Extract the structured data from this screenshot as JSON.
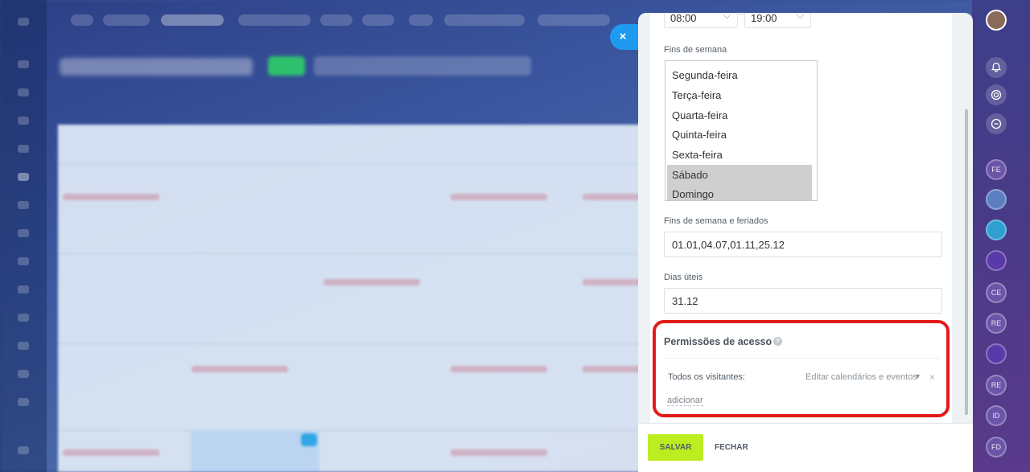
{
  "background": {
    "description_hidden": true
  },
  "panel": {
    "time_start": "08:00",
    "time_end": "19:00",
    "weekends_label": "Fins de semana",
    "weekdays": [
      {
        "label": "Segunda-feira",
        "selected": false
      },
      {
        "label": "Terça-feira",
        "selected": false
      },
      {
        "label": "Quarta-feira",
        "selected": false
      },
      {
        "label": "Quinta-feira",
        "selected": false
      },
      {
        "label": "Sexta-feira",
        "selected": false
      },
      {
        "label": "Sábado",
        "selected": true
      },
      {
        "label": "Domingo",
        "selected": true
      }
    ],
    "holidays_label": "Fins de semana e feriados",
    "holidays_value": "01.01,04.07,01.11,25.12",
    "workdays_label": "Dias úteis",
    "workdays_value": "31.12",
    "permissions": {
      "title": "Permissões de acesso",
      "help_icon": "?",
      "rows": [
        {
          "who": "Todos os visitantes:",
          "level": "Editar calendários e eventos",
          "remove_icon": "×"
        }
      ],
      "add_label": "adicionar"
    }
  },
  "footer": {
    "save_label": "SALVAR",
    "close_label": "FECHAR"
  },
  "close_icon": "×",
  "right_bar": {
    "icons": [
      "bell-icon",
      "target-icon",
      "chat-icon"
    ],
    "avatars": [
      "FE",
      "",
      "",
      "",
      "CE",
      "RE",
      "",
      "RE",
      "ID",
      "FD"
    ]
  },
  "colors": {
    "save_button": "#bbed21",
    "highlight": "#e31b1b",
    "close_circle": "#1e9bf0"
  }
}
